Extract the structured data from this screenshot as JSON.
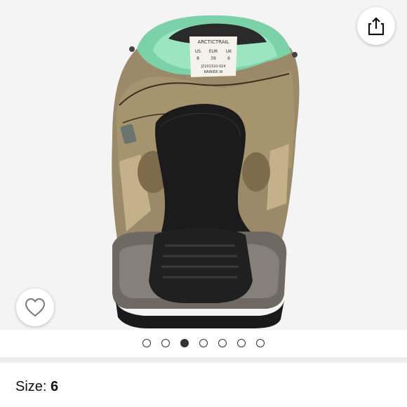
{
  "product_image": {
    "alt_description": "hiking-boot-rear-view",
    "label_text": {
      "brand": "ARCTICTRAIL",
      "size_headers": [
        "US",
        "EUR",
        "UK"
      ],
      "size_values": [
        "8",
        "39",
        "6"
      ],
      "code": "J2101310-024",
      "model": "RAINIER W"
    }
  },
  "actions": {
    "share_icon": "share-icon",
    "wishlist_icon": "heart-icon"
  },
  "carousel": {
    "total_images": 7,
    "active_index": 2
  },
  "size": {
    "label": "Size: ",
    "value": "6"
  }
}
